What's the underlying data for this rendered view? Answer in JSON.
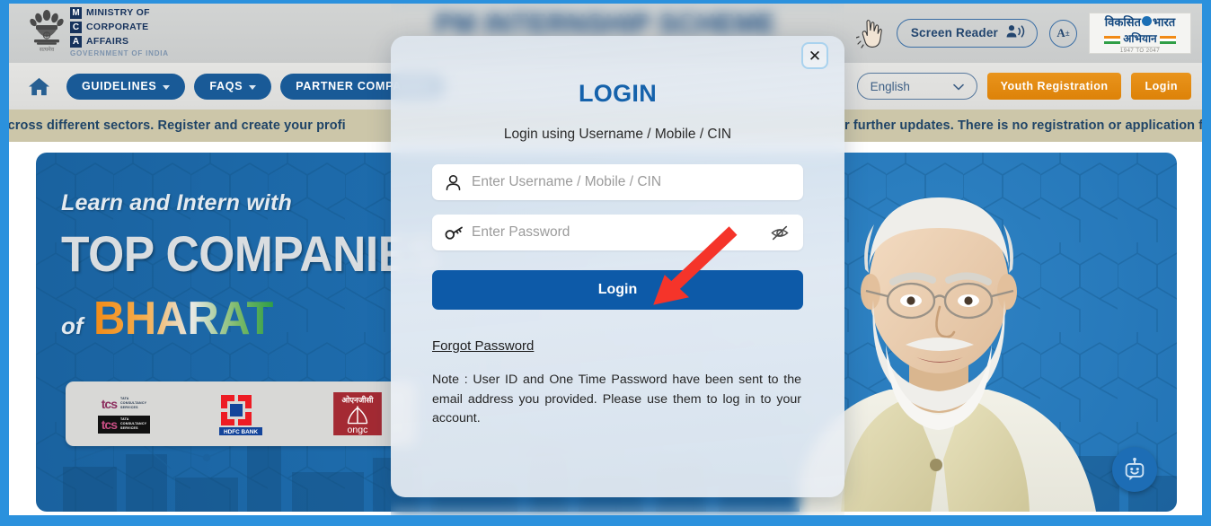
{
  "site": {
    "title": "PM INTERNSHIP SCHEME",
    "ministry": {
      "line1": "MINISTRY OF",
      "line2": "CORPORATE",
      "line3": "AFFAIRS",
      "sub": "GOVERNMENT OF INDIA",
      "badge1": "M",
      "badge2": "C",
      "badge3": "A"
    },
    "viksit_bharat": {
      "line1_a": "विकसित",
      "line1_b": "भारत",
      "line2": "अभियान",
      "years": "1947 TO 2047"
    }
  },
  "header": {
    "accessibility_icon": "accessibility-hand-icon",
    "screen_reader_label": "Screen Reader",
    "screen_reader_icon": "speaker-person-icon",
    "font_size_label": "A",
    "font_size_sup": "±"
  },
  "nav": {
    "home_icon": "home-icon",
    "items": [
      {
        "label": "GUIDELINES",
        "has_caret": true
      },
      {
        "label": "FAQS",
        "has_caret": true
      },
      {
        "label": "PARTNER COMPANIES",
        "has_caret": false
      }
    ],
    "language": {
      "selected": "English",
      "caret_icon": "chevron-down-icon"
    },
    "youth_registration_label": "Youth Registration",
    "login_label": "Login"
  },
  "notice": {
    "left_text": "es across different sectors. Register and create your profi",
    "right_text": "r further updates. There is no registration or application f"
  },
  "hero": {
    "line1": "Learn and Intern with",
    "line2": "TOP COMPANIES",
    "of": "of",
    "bharat": "BHARAT",
    "partners": [
      {
        "name": "tcs",
        "label": "tcs",
        "sub": "TATA\nCONSULTANCY\nSERVICES"
      },
      {
        "name": "hdfc-bank",
        "label": "HDFC BANK"
      },
      {
        "name": "ongc",
        "label": "ongc",
        "hindi": "ओएनजीसी"
      }
    ],
    "pm_photo_alt": "prime-minister-portrait"
  },
  "chatbot": {
    "icon": "chatbot-icon"
  },
  "login_modal": {
    "close_icon": "close-icon",
    "close_label": "✕",
    "title": "LOGIN",
    "subtitle": "Login using Username / Mobile / CIN",
    "username": {
      "icon": "user-icon",
      "placeholder": "Enter Username / Mobile / CIN",
      "value": ""
    },
    "password": {
      "icon": "key-icon",
      "placeholder": "Enter Password",
      "value": "",
      "toggle_icon": "eye-off-icon"
    },
    "submit_label": "Login",
    "forgot_password_label": "Forgot Password",
    "note": "Note : User ID and One Time Password have been sent to the email address you provided. Please use them to log in to your account."
  },
  "annotation": {
    "arrow_color": "#f5342a",
    "points_to": "login-submit"
  },
  "colors": {
    "accent_blue": "#0d5aa8",
    "title_blue": "#1562ab",
    "nav_pill_blue": "#195a97",
    "orange": "#e58a16",
    "notice_bg": "#ccc6a9",
    "frame_blue": "#2b91dd"
  }
}
